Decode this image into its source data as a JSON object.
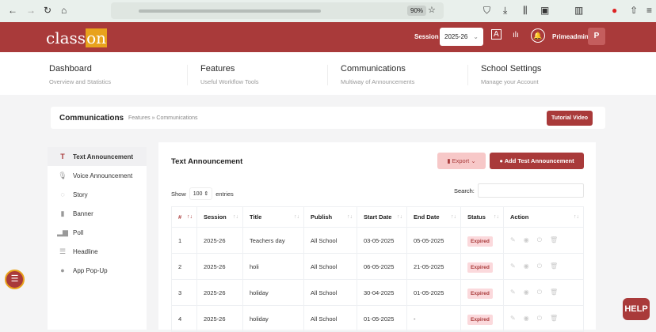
{
  "browser": {
    "zoom": "90%"
  },
  "header": {
    "logo": "class",
    "logo_accent": "on",
    "session_label": "Session",
    "session_value": "2025-26",
    "username": "Primeadmin",
    "avatar": "P"
  },
  "nav": [
    {
      "title": "Dashboard",
      "subtitle": "Overview and Statistics"
    },
    {
      "title": "Features",
      "subtitle": "Useful Workflow Tools"
    },
    {
      "title": "Communications",
      "subtitle": "Multiway of Announcements"
    },
    {
      "title": "School Settings",
      "subtitle": "Manage your Account"
    }
  ],
  "breadcrumb": {
    "title": "Communications",
    "path": "Features  »  Communications",
    "tutorial": "Tutorial Video"
  },
  "sidebar": [
    {
      "label": "Text Announcement",
      "icon": "T"
    },
    {
      "label": "Voice Announcement",
      "icon": "🎙"
    },
    {
      "label": "Story",
      "icon": "◌"
    },
    {
      "label": "Banner",
      "icon": "▮"
    },
    {
      "label": "Poll",
      "icon": "▂▆"
    },
    {
      "label": "Headline",
      "icon": "☰"
    },
    {
      "label": "App Pop-Up",
      "icon": "●"
    }
  ],
  "main": {
    "title": "Text Announcement",
    "export": "Export",
    "add": "Add Test Announcement",
    "show": "Show",
    "entries_value": "100",
    "entries": "entries",
    "search_label": "Search:",
    "columns": [
      "#",
      "Session",
      "Title",
      "Publish",
      "Start Date",
      "End Date",
      "Status",
      "Action"
    ],
    "rows": [
      [
        "1",
        "2025-26",
        "Teachers day",
        "All School",
        "03-05-2025",
        "05-05-2025",
        "Expired"
      ],
      [
        "2",
        "2025-26",
        "holi",
        "All School",
        "06-05-2025",
        "21-05-2025",
        "Expired"
      ],
      [
        "3",
        "2025-26",
        "holiday",
        "All School",
        "30-04-2025",
        "01-05-2025",
        "Expired"
      ],
      [
        "4",
        "2025-26",
        "holiday",
        "All School",
        "01-05-2025",
        "-",
        "Expired"
      ]
    ]
  },
  "help": "HELP"
}
